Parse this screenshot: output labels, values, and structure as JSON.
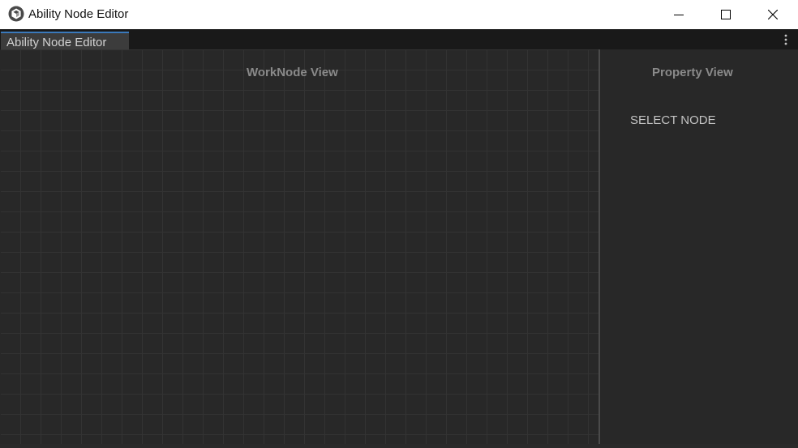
{
  "window": {
    "title": "Ability Node Editor",
    "icon": "unity-logo-icon",
    "controls": [
      "minimize-icon",
      "maximize-icon",
      "close-icon"
    ]
  },
  "tabs": [
    {
      "label": "Ability Node Editor",
      "active": true
    }
  ],
  "menu_icon": "kebab-menu-icon",
  "worknode_view": {
    "title": "WorkNode View"
  },
  "property_view": {
    "title": "Property View",
    "message": "SELECT NODE"
  },
  "colors": {
    "accent": "#3a79bb",
    "background": "#282828",
    "grid": "#333333"
  }
}
